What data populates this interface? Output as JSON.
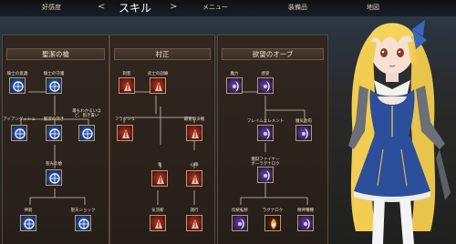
{
  "nav": {
    "left_arrow": "<",
    "right_arrow": ">",
    "items": [
      "好感度",
      "スキル",
      "メニュー",
      "装備品",
      "地図"
    ]
  },
  "panels": [
    {
      "title": "聖潔の槍",
      "labels": [
        "騎士の意識",
        "騎士の守護",
        "アイアンダッシュ",
        "聖潔の突き",
        "最もわかるいほど、抱き責い",
        "聖光の槍",
        "神罰",
        "聖天ショック"
      ]
    },
    {
      "title": "村正",
      "labels": [
        "刺客",
        "武士の訓練",
        "フラッシュ",
        "最後の決戦",
        "鬼",
        "心眼",
        "気流斬",
        "諸行"
      ]
    },
    {
      "title": "欲望のオーブ",
      "labels": [
        "魔力",
        "感受",
        "フレイムエレメント",
        "魔気治愈",
        "獲獄ファイヤーボーラグナロク",
        "伝統転移",
        "ラグナロク",
        "精神種種"
      ]
    }
  ],
  "colors": {
    "blue": "#2b4f9a",
    "red": "#9a2a1e",
    "purple": "#4a2f78",
    "frame": "#b49a6e"
  },
  "icons": {
    "p1": [
      "heart-shield-icon",
      "shield-cross-icon",
      "horse-icon",
      "spear-thrust-icon",
      "sparkle-burst-icon",
      "swirl-icon",
      "skull-icon",
      "shield-burst-icon"
    ],
    "p2": [
      "hooded-figure-icon",
      "samurai-icon",
      "scroll-icon",
      "flame-burst-icon",
      "vortex-icon",
      "starburst-icon",
      "slash-icon",
      "blade-icon"
    ],
    "p3": [
      "crescent-icon",
      "eye-orb-icon",
      "flame-orb-icon",
      "cyclone-icon",
      "flame-pillar-icon",
      "flower-icon",
      "fire-icon",
      "arrows-icon"
    ]
  }
}
